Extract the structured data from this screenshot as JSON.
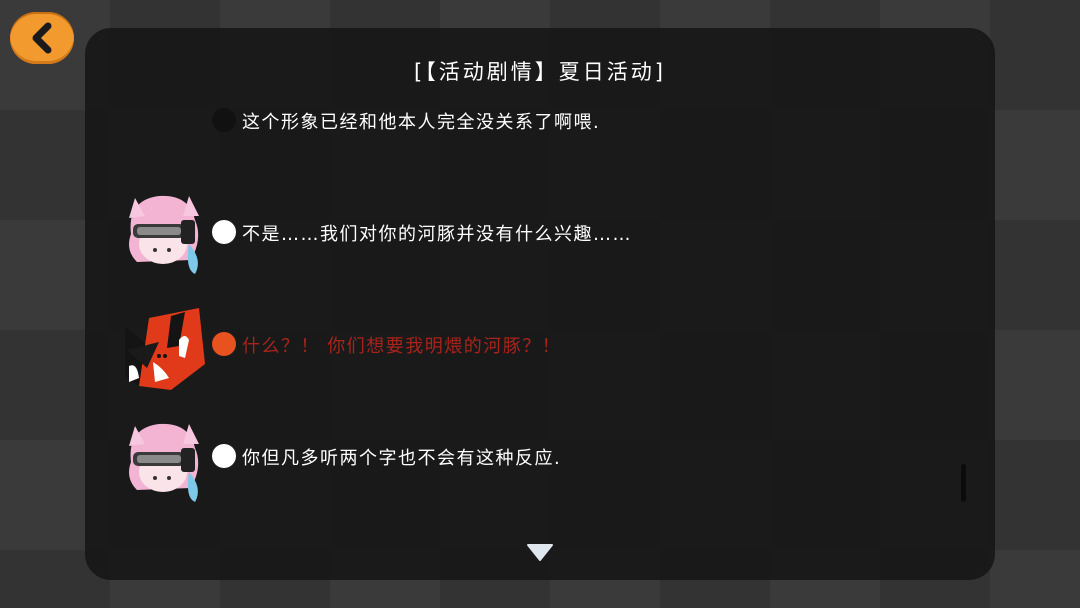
{
  "header": {
    "back_icon": "chevron-left-icon"
  },
  "dialog": {
    "title": "[【活动剧情】夏日活动]",
    "lines": [
      {
        "speaker_icon": "none",
        "dot_color": "#111111",
        "text": "这个形象已经和他本人完全没关系了啊喂.",
        "text_color": "#ffffff"
      },
      {
        "speaker_icon": "pink-hair-goggles-avatar",
        "dot_color": "#ffffff",
        "text": "不是……我们对你的河豚并没有什么兴趣……",
        "text_color": "#ffffff"
      },
      {
        "speaker_icon": "red-black-fox-mask-avatar",
        "dot_color": "#e8521f",
        "text": "什么？！ 你们想要我明煨的河豚？！",
        "text_color": "#a8231b"
      },
      {
        "speaker_icon": "pink-hair-goggles-avatar",
        "dot_color": "#ffffff",
        "text": "你但凡多听两个字也不会有这种反应.",
        "text_color": "#ffffff"
      }
    ],
    "more_icon": "triangle-down-icon"
  },
  "colors": {
    "accent": "#f39a2f",
    "panel_bg": "#181818",
    "alert_text": "#a8231b"
  }
}
